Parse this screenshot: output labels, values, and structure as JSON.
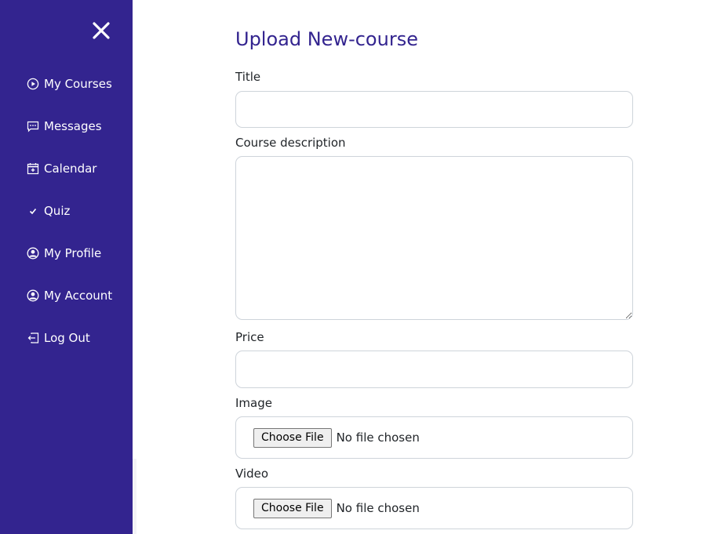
{
  "sidebar": {
    "close_icon": "close-icon",
    "items": [
      {
        "label": "My Courses",
        "icon": "play-circle-icon"
      },
      {
        "label": "Messages",
        "icon": "chat-dots-icon"
      },
      {
        "label": "Calendar",
        "icon": "calendar-plus-icon"
      },
      {
        "label": "Quiz",
        "icon": "check-icon"
      },
      {
        "label": "My Profile",
        "icon": "person-circle-icon"
      },
      {
        "label": "My Account",
        "icon": "person-circle-icon"
      },
      {
        "label": "Log Out",
        "icon": "box-arrow-left-icon"
      }
    ]
  },
  "form": {
    "title": "Upload New-course",
    "title_label": "Title",
    "title_value": "",
    "description_label": "Course description",
    "description_value": "",
    "price_label": "Price",
    "price_value": "",
    "image_label": "Image",
    "image_button": "Choose File",
    "image_status": "No file chosen",
    "video_label": "Video",
    "video_button": "Choose File",
    "video_status": "No file chosen"
  },
  "colors": {
    "sidebar_bg": "#33248f",
    "title_color": "#33248f"
  }
}
